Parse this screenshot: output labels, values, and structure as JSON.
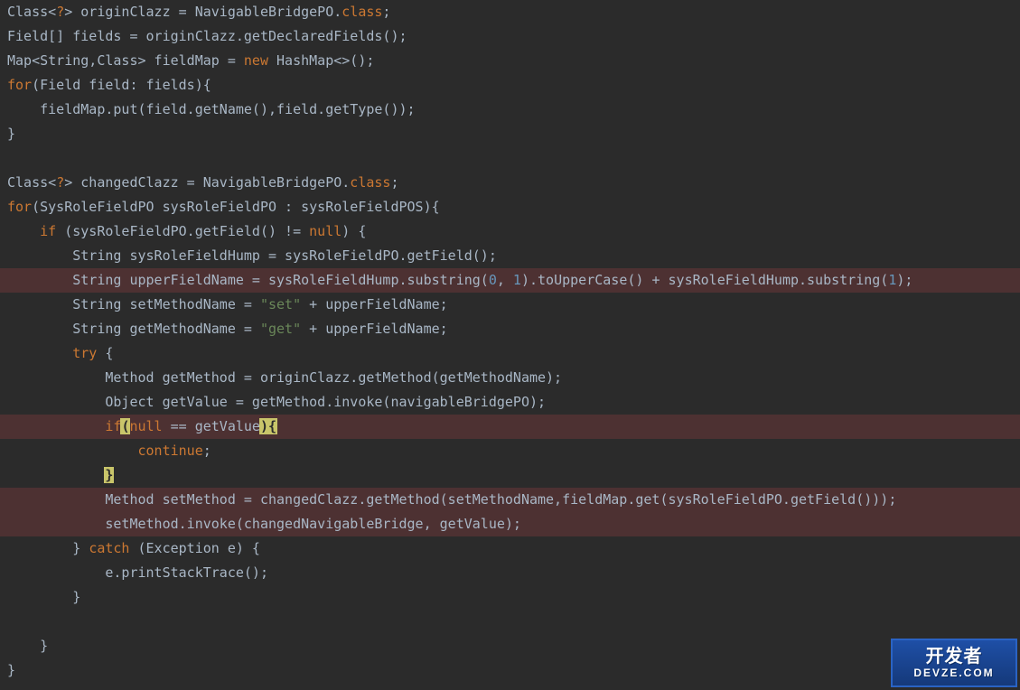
{
  "code": {
    "lines": [
      {
        "hl": false,
        "tokens": [
          {
            "c": "default",
            "t": "Class<"
          },
          {
            "c": "keyword",
            "t": "?"
          },
          {
            "c": "default",
            "t": "> originClazz = NavigableBridgePO."
          },
          {
            "c": "keyword",
            "t": "class"
          },
          {
            "c": "default",
            "t": ";"
          }
        ]
      },
      {
        "hl": false,
        "tokens": [
          {
            "c": "default",
            "t": "Field[] fields = originClazz.getDeclaredFields();"
          }
        ]
      },
      {
        "hl": false,
        "tokens": [
          {
            "c": "default",
            "t": "Map<String,Class> fieldMap = "
          },
          {
            "c": "keyword",
            "t": "new "
          },
          {
            "c": "default",
            "t": "HashMap<>();"
          }
        ]
      },
      {
        "hl": false,
        "tokens": [
          {
            "c": "keyword",
            "t": "for"
          },
          {
            "c": "default",
            "t": "(Field field: fields){"
          }
        ]
      },
      {
        "hl": false,
        "tokens": [
          {
            "c": "default",
            "t": "    fieldMap.put(field.getName(),field.getType());"
          }
        ]
      },
      {
        "hl": false,
        "tokens": [
          {
            "c": "default",
            "t": "}"
          }
        ]
      },
      {
        "hl": false,
        "tokens": [
          {
            "c": "default",
            "t": ""
          }
        ]
      },
      {
        "hl": false,
        "tokens": [
          {
            "c": "default",
            "t": "Class<"
          },
          {
            "c": "keyword",
            "t": "?"
          },
          {
            "c": "default",
            "t": "> changedClazz = NavigableBridgePO."
          },
          {
            "c": "keyword",
            "t": "class"
          },
          {
            "c": "default",
            "t": ";"
          }
        ]
      },
      {
        "hl": false,
        "tokens": [
          {
            "c": "keyword",
            "t": "for"
          },
          {
            "c": "default",
            "t": "(SysRoleFieldPO sysRoleFieldPO : sysRoleFieldPOS){"
          }
        ]
      },
      {
        "hl": false,
        "tokens": [
          {
            "c": "default",
            "t": "    "
          },
          {
            "c": "keyword",
            "t": "if "
          },
          {
            "c": "default",
            "t": "(sysRoleFieldPO.getField() != "
          },
          {
            "c": "keyword",
            "t": "null"
          },
          {
            "c": "default",
            "t": ") {"
          }
        ]
      },
      {
        "hl": false,
        "tokens": [
          {
            "c": "default",
            "t": "        String sysRoleFieldHump = sysRoleFieldPO.getField();"
          }
        ]
      },
      {
        "hl": true,
        "tokens": [
          {
            "c": "default",
            "t": "        String upperFieldName = sysRoleFieldHump.substring("
          },
          {
            "c": "number",
            "t": "0"
          },
          {
            "c": "default",
            "t": ", "
          },
          {
            "c": "number",
            "t": "1"
          },
          {
            "c": "default",
            "t": ").toUpperCase() + sysRoleFieldHump.substring("
          },
          {
            "c": "number",
            "t": "1"
          },
          {
            "c": "default",
            "t": ");"
          }
        ]
      },
      {
        "hl": false,
        "tokens": [
          {
            "c": "default",
            "t": "        String setMethodName = "
          },
          {
            "c": "string",
            "t": "\"set\" "
          },
          {
            "c": "default",
            "t": "+ upperFieldName;"
          }
        ]
      },
      {
        "hl": false,
        "tokens": [
          {
            "c": "default",
            "t": "        String getMethodName = "
          },
          {
            "c": "string",
            "t": "\"get\" "
          },
          {
            "c": "default",
            "t": "+ upperFieldName;"
          }
        ]
      },
      {
        "hl": false,
        "tokens": [
          {
            "c": "default",
            "t": "        "
          },
          {
            "c": "keyword",
            "t": "try "
          },
          {
            "c": "default",
            "t": "{"
          }
        ]
      },
      {
        "hl": false,
        "tokens": [
          {
            "c": "default",
            "t": "            Method getMethod = originClazz.getMethod(getMethodName);"
          }
        ]
      },
      {
        "hl": false,
        "tokens": [
          {
            "c": "default",
            "t": "            Object getValue = getMethod.invoke(navigableBridgePO);"
          }
        ]
      },
      {
        "hl": true,
        "tokens": [
          {
            "c": "default",
            "t": "            "
          },
          {
            "c": "keyword",
            "t": "if"
          },
          {
            "c": "caret",
            "t": "("
          },
          {
            "c": "keyword",
            "t": "null "
          },
          {
            "c": "default",
            "t": "== getValue"
          },
          {
            "c": "caret",
            "t": ")"
          },
          {
            "c": "caret",
            "t": "{"
          }
        ]
      },
      {
        "hl": false,
        "tokens": [
          {
            "c": "default",
            "t": "                "
          },
          {
            "c": "keyword",
            "t": "continue"
          },
          {
            "c": "default",
            "t": ";"
          }
        ]
      },
      {
        "hl": false,
        "tokens": [
          {
            "c": "default",
            "t": "            "
          },
          {
            "c": "caret",
            "t": "}"
          }
        ]
      },
      {
        "hl": true,
        "tokens": [
          {
            "c": "default",
            "t": "            Method setMethod = changedClazz.getMethod(setMethodName,fieldMap.get(sysRoleFieldPO.getField()));"
          }
        ]
      },
      {
        "hl": true,
        "tokens": [
          {
            "c": "default",
            "t": "            setMethod.invoke(changedNavigableBridge, getValue);"
          }
        ]
      },
      {
        "hl": false,
        "tokens": [
          {
            "c": "default",
            "t": "        } "
          },
          {
            "c": "keyword",
            "t": "catch "
          },
          {
            "c": "default",
            "t": "(Exception e) {"
          }
        ]
      },
      {
        "hl": false,
        "tokens": [
          {
            "c": "default",
            "t": "            e.printStackTrace();"
          }
        ]
      },
      {
        "hl": false,
        "tokens": [
          {
            "c": "default",
            "t": "        }"
          }
        ]
      },
      {
        "hl": false,
        "tokens": [
          {
            "c": "default",
            "t": ""
          }
        ]
      },
      {
        "hl": false,
        "tokens": [
          {
            "c": "default",
            "t": "    }"
          }
        ]
      },
      {
        "hl": false,
        "tokens": [
          {
            "c": "default",
            "t": "}"
          }
        ]
      }
    ]
  },
  "watermark": {
    "line1": "开发者",
    "line2": "DEVZE.COM"
  }
}
